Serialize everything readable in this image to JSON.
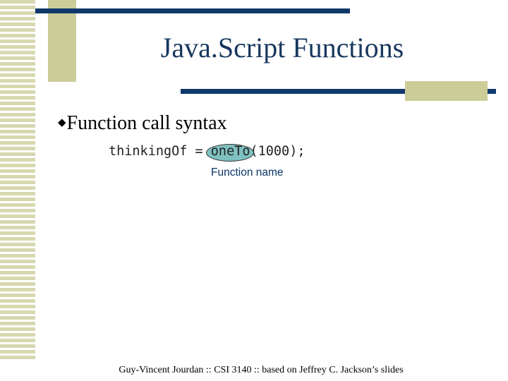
{
  "slide": {
    "title": "Java.Script Functions",
    "bullet": {
      "icon": "diamond-bullet-icon",
      "text": "Function call syntax"
    },
    "code": {
      "before": "thinkingOf = ",
      "highlighted": "oneTo",
      "after": "(1000);"
    },
    "callout": "Function name",
    "footer": "Guy-Vincent Jourdan :: CSI 3140 :: based on Jeffrey C. Jackson’s slides"
  },
  "colors": {
    "title": "#17375e",
    "rule": "#10386a",
    "accent_tan": "#cccc99",
    "highlight": "#7fc0c0",
    "callout": "#0a3466"
  }
}
